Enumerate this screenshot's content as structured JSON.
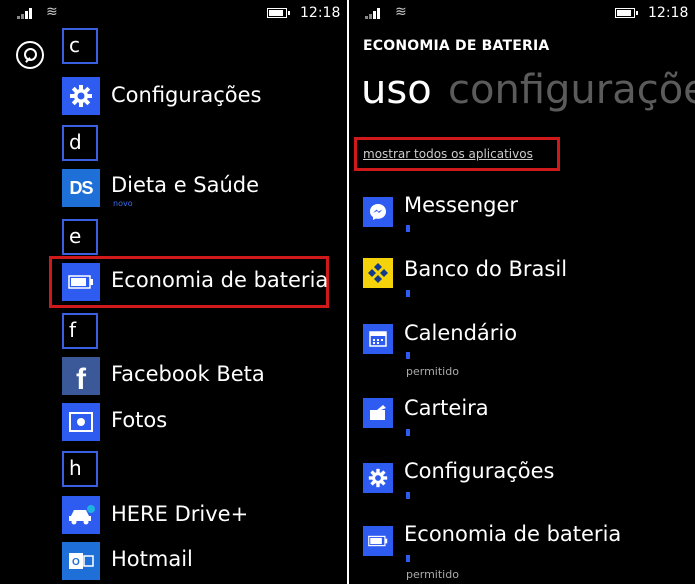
{
  "left_screen": {
    "status_bar": {
      "time": "12:18"
    },
    "search_icon": "search-icon",
    "groups": [
      {
        "letter": "c",
        "apps": [
          {
            "name": "Configurações",
            "icon": "gear-icon"
          }
        ]
      },
      {
        "letter": "d",
        "apps": [
          {
            "name": "Dieta e Saúde",
            "icon": "ds-logo-icon",
            "tag": "novo"
          }
        ]
      },
      {
        "letter": "e",
        "apps": [
          {
            "name": "Economia de bateria",
            "icon": "battery-icon",
            "highlighted": true
          }
        ]
      },
      {
        "letter": "f",
        "apps": [
          {
            "name": "Facebook Beta",
            "icon": "facebook-icon"
          },
          {
            "name": "Fotos",
            "icon": "photo-icon"
          }
        ]
      },
      {
        "letter": "h",
        "apps": [
          {
            "name": "HERE Drive+",
            "icon": "car-icon"
          },
          {
            "name": "Hotmail",
            "icon": "outlook-icon"
          }
        ]
      }
    ]
  },
  "right_screen": {
    "status_bar": {
      "time": "12:18"
    },
    "app_title": "ECONOMIA DE BATERIA",
    "pivot": {
      "active": "uso",
      "inactive": "configurações"
    },
    "show_all_link": "mostrar todos os aplicativos",
    "apps": [
      {
        "name": "Messenger",
        "icon": "messenger-icon",
        "status": ""
      },
      {
        "name": "Banco do Brasil",
        "icon": "banco-do-brasil-icon",
        "status": ""
      },
      {
        "name": "Calendário",
        "icon": "calendar-icon",
        "status": "permitido"
      },
      {
        "name": "Carteira",
        "icon": "wallet-icon",
        "status": ""
      },
      {
        "name": "Configurações",
        "icon": "gear-icon",
        "status": ""
      },
      {
        "name": "Economia de bateria",
        "icon": "battery-icon",
        "status": "permitido"
      }
    ]
  },
  "colors": {
    "accent": "#2f5cf0",
    "highlight": "#d0191b",
    "background": "#000000",
    "pivot_inactive": "#5b5b5b"
  }
}
